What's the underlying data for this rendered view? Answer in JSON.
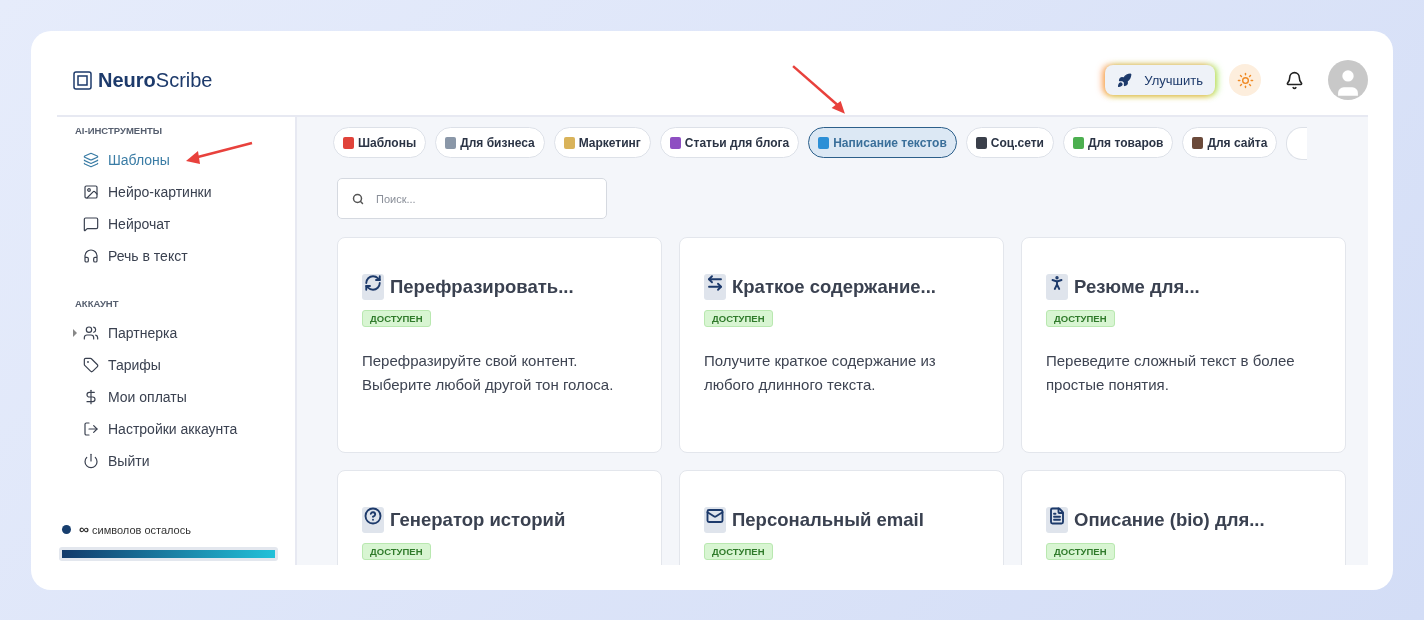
{
  "logo": {
    "bold": "Neuro",
    "light": "Scribe"
  },
  "header": {
    "upgrade": "Улучшить"
  },
  "sidebar": {
    "sections": [
      {
        "title": "AI-ИНСТРУМЕНТЫ",
        "items": [
          {
            "label": "Шаблоны",
            "selected": true,
            "expandable": false
          },
          {
            "label": "Нейро-картинки",
            "selected": false,
            "expandable": false
          },
          {
            "label": "Нейрочат",
            "selected": false,
            "expandable": false
          },
          {
            "label": "Речь в текст",
            "selected": false,
            "expandable": false
          }
        ]
      },
      {
        "title": "АККАУНТ",
        "items": [
          {
            "label": "Партнерка",
            "selected": false,
            "expandable": true
          },
          {
            "label": "Тарифы",
            "selected": false,
            "expandable": false
          },
          {
            "label": "Мои оплаты",
            "selected": false,
            "expandable": false
          },
          {
            "label": "Настройки аккаунта",
            "selected": false,
            "expandable": false
          },
          {
            "label": "Выйти",
            "selected": false,
            "expandable": false
          }
        ]
      }
    ],
    "credits": {
      "amount": "∞",
      "text": "символов осталось",
      "level": 1
    }
  },
  "categories": [
    {
      "label": "Шаблоны",
      "color": "#e0433a",
      "selected": false
    },
    {
      "label": "Для бизнеса",
      "color": "#8a97a8",
      "selected": false
    },
    {
      "label": "Маркетинг",
      "color": "#d9b35a",
      "selected": false
    },
    {
      "label": "Статьи для блога",
      "color": "#8e4fc2",
      "selected": false
    },
    {
      "label": "Написание текстов",
      "color": "#2c8fd6",
      "selected": true
    },
    {
      "label": "Соц.сети",
      "color": "#3a3f4a",
      "selected": false
    },
    {
      "label": "Для товаров",
      "color": "#4caf50",
      "selected": false
    },
    {
      "label": "Для сайта",
      "color": "#6b4a3a",
      "selected": false
    }
  ],
  "search": {
    "placeholder": "Поиск..."
  },
  "templates": [
    {
      "title": "Перефразировать...",
      "badge": "ДОСТУПЕН",
      "description": "Перефразируйте свой контент. Выберите любой другой тон голоса."
    },
    {
      "title": "Краткое содержание...",
      "badge": "ДОСТУПЕН",
      "description": "Получите краткое содержание из любого длинного текста."
    },
    {
      "title": "Резюме для...",
      "badge": "ДОСТУПЕН",
      "description": "Переведите сложный текст в более простые понятия."
    },
    {
      "title": "Генератор историй",
      "badge": "ДОСТУПЕН"
    },
    {
      "title": "Персональный email",
      "badge": "ДОСТУПЕН"
    },
    {
      "title": "Описание (bio) для...",
      "badge": "ДОСТУПЕН"
    }
  ]
}
